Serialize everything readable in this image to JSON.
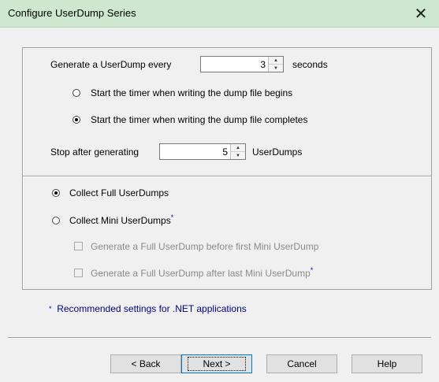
{
  "window": {
    "title": "Configure UserDump Series",
    "close_glyph": "✕"
  },
  "schedule": {
    "generate_label": "Generate a UserDump every",
    "interval_value": "3",
    "interval_unit": "seconds",
    "timer_options": [
      {
        "label": "Start the timer when writing the dump file begins",
        "selected": false
      },
      {
        "label": "Start the timer when writing the dump file completes",
        "selected": true
      }
    ],
    "stop_label": "Stop after generating",
    "stop_value": "5",
    "stop_unit": "UserDumps"
  },
  "dump_type": {
    "full_label": "Collect Full UserDumps",
    "mini_label": "Collect Mini UserDumps",
    "mini_marker": "*",
    "full_before_label": "Generate a Full UserDump before first Mini UserDump",
    "full_after_label": "Generate a Full UserDump after last Mini UserDump",
    "full_after_marker": "*"
  },
  "note": {
    "marker": "*",
    "text": "Recommended settings for .NET applications"
  },
  "buttons": {
    "back": "< Back",
    "next": "Next >",
    "cancel": "Cancel",
    "help": "Help"
  }
}
